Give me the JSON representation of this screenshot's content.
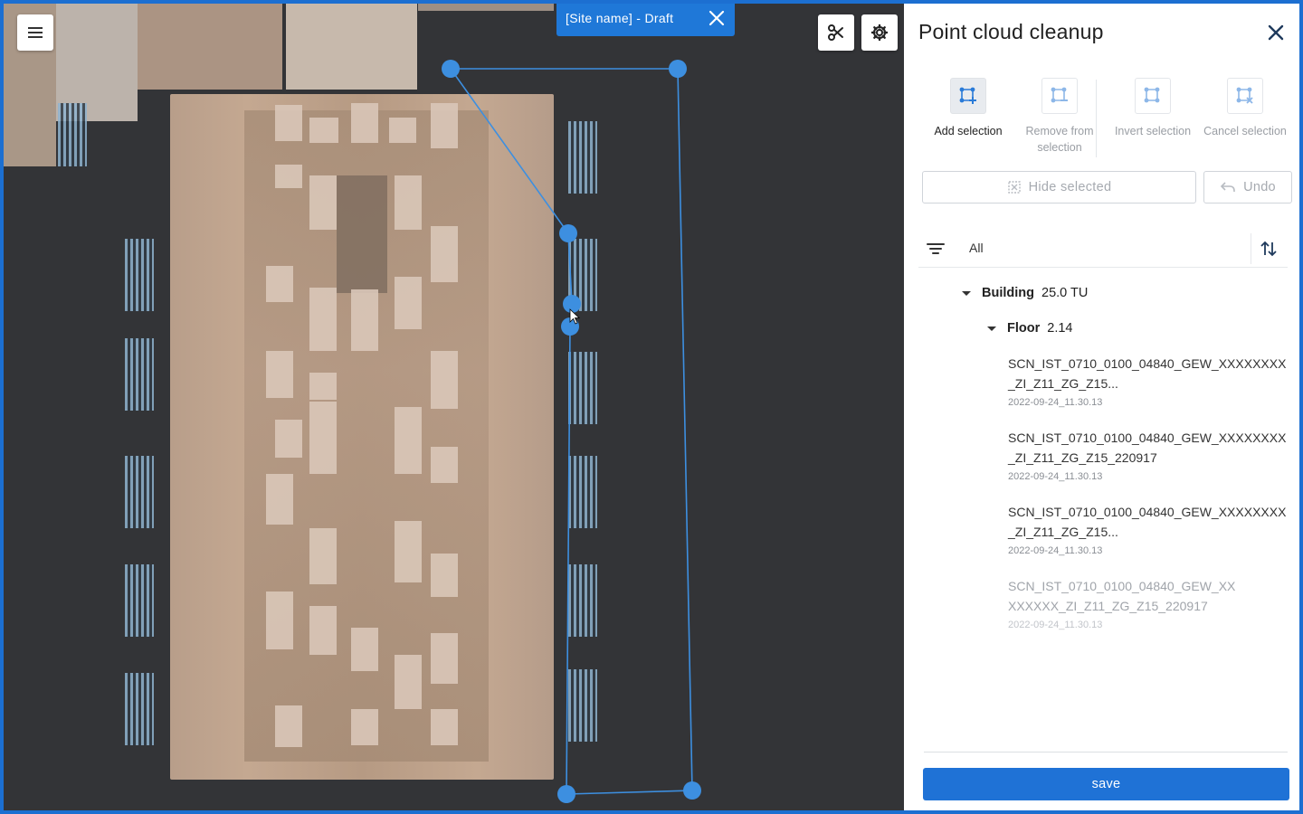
{
  "app": {
    "site_chip": "[Site name] - Draft",
    "accent_color": "#1f78d8"
  },
  "viewport": {
    "menu_icon": "hamburger-menu-icon",
    "cut_tool_icon": "scissors-icon",
    "settings_icon": "gear-icon"
  },
  "panel": {
    "title": "Point cloud cleanup",
    "tools": [
      {
        "label": "Add selection",
        "active": true,
        "icon": "polygon-add-icon"
      },
      {
        "label": "Remove from selection",
        "active": false,
        "icon": "polygon-remove-icon"
      },
      {
        "label": "Invert selection",
        "active": false,
        "icon": "polygon-invert-icon"
      },
      {
        "label": "Cancel selection",
        "active": false,
        "icon": "polygon-cancel-icon"
      }
    ],
    "hide_selected": "Hide selected",
    "undo": "Undo",
    "filter_label": "All",
    "tree": {
      "building": {
        "label": "Building",
        "value": "25.0 TU"
      },
      "floor": {
        "label": "Floor",
        "value": "2.14"
      },
      "scans": [
        {
          "name": "SCN_IST_0710_0100_04840_GEW_XXXXXXXX_ZI_Z11_ZG_Z15...",
          "date": "2022-09-24_11.30.13"
        },
        {
          "name": "SCN_IST_0710_0100_04840_GEW_XXXXXXXX_ZI_Z11_ZG_Z15_220917",
          "date": "2022-09-24_11.30.13"
        },
        {
          "name": "SCN_IST_0710_0100_04840_GEW_XXXXXXXX_ZI_Z11_ZG_Z15...",
          "date": "2022-09-24_11.30.13"
        },
        {
          "name": "SCN_IST_0710_0100_04840_GEW_XXXXXXXX_ZI_Z11_ZG_Z15_220917",
          "date": "2022-09-24_11.30.13",
          "dim": true
        }
      ]
    },
    "save": "save"
  }
}
